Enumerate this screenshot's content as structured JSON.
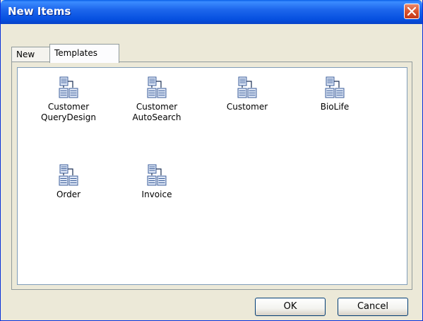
{
  "window": {
    "title": "New Items"
  },
  "tabs": [
    {
      "label": "New",
      "active": false
    },
    {
      "label": "Templates",
      "active": true
    }
  ],
  "items": [
    {
      "label": "Customer\nQueryDesign",
      "icon": "data-module-icon"
    },
    {
      "label": "Customer\nAutoSearch",
      "icon": "data-module-icon"
    },
    {
      "label": "Customer",
      "icon": "data-module-icon"
    },
    {
      "label": "BioLife",
      "icon": "data-module-icon"
    },
    {
      "label": "Order",
      "icon": "data-module-icon"
    },
    {
      "label": "Invoice",
      "icon": "data-module-icon"
    }
  ],
  "buttons": {
    "ok": "OK",
    "cancel": "Cancel"
  },
  "colors": {
    "titlebar": "#0a5fe8",
    "close": "#d9532d",
    "face": "#ece9d8"
  }
}
